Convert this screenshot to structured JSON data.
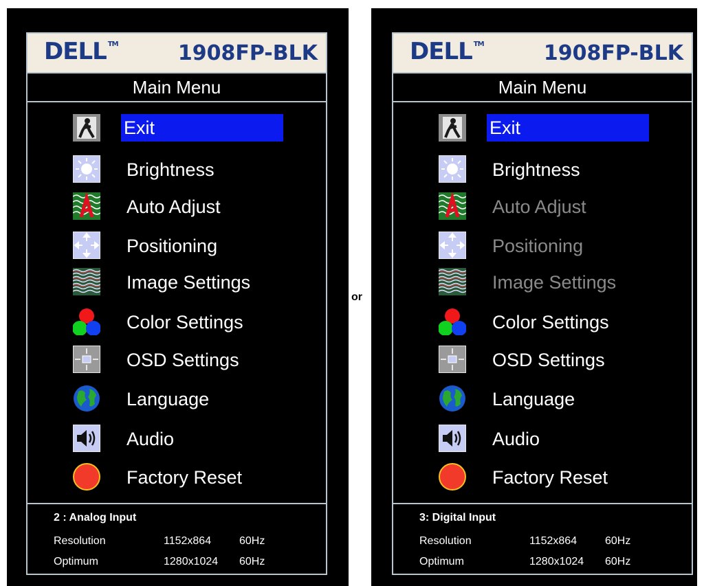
{
  "separator": "or",
  "panels": {
    "left": {
      "logo": "DELL",
      "trademark": "TM",
      "model": "1908FP-BLK",
      "menu_title": "Main Menu",
      "items": [
        {
          "label": "Exit",
          "icon": "exit-icon",
          "state": "selected"
        },
        {
          "label": "Brightness",
          "icon": "brightness-icon",
          "state": "normal"
        },
        {
          "label": "Auto Adjust",
          "icon": "auto-adjust-icon",
          "state": "normal"
        },
        {
          "label": "Positioning",
          "icon": "positioning-icon",
          "state": "normal"
        },
        {
          "label": "Image Settings",
          "icon": "image-settings-icon",
          "state": "normal"
        },
        {
          "label": "Color Settings",
          "icon": "color-settings-icon",
          "state": "normal"
        },
        {
          "label": "OSD Settings",
          "icon": "osd-settings-icon",
          "state": "normal"
        },
        {
          "label": "Language",
          "icon": "globe-icon",
          "state": "normal"
        },
        {
          "label": "Audio",
          "icon": "speaker-icon",
          "state": "normal"
        },
        {
          "label": "Factory Reset",
          "icon": "factory-reset-icon",
          "state": "normal"
        }
      ],
      "info": {
        "input_label": "2 : Analog Input",
        "resolution_label": "Resolution",
        "resolution_value": "1152x864",
        "resolution_hz": "60Hz",
        "optimum_label": "Optimum",
        "optimum_value": "1280x1024",
        "optimum_hz": "60Hz"
      }
    },
    "right": {
      "logo": "DELL",
      "trademark": "TM",
      "model": "1908FP-BLK",
      "menu_title": "Main Menu",
      "items": [
        {
          "label": "Exit",
          "icon": "exit-icon",
          "state": "selected"
        },
        {
          "label": "Brightness",
          "icon": "brightness-icon",
          "state": "normal"
        },
        {
          "label": "Auto Adjust",
          "icon": "auto-adjust-icon",
          "state": "disabled"
        },
        {
          "label": "Positioning",
          "icon": "positioning-icon",
          "state": "disabled"
        },
        {
          "label": "Image Settings",
          "icon": "image-settings-icon",
          "state": "disabled"
        },
        {
          "label": "Color Settings",
          "icon": "color-settings-icon",
          "state": "normal"
        },
        {
          "label": "OSD Settings",
          "icon": "osd-settings-icon",
          "state": "normal"
        },
        {
          "label": "Language",
          "icon": "globe-icon",
          "state": "normal"
        },
        {
          "label": "Audio",
          "icon": "speaker-icon",
          "state": "normal"
        },
        {
          "label": "Factory Reset",
          "icon": "factory-reset-icon",
          "state": "normal"
        }
      ],
      "info": {
        "input_label": "3: Digital Input",
        "resolution_label": "Resolution",
        "resolution_value": "1152x864",
        "resolution_hz": "60Hz",
        "optimum_label": "Optimum",
        "optimum_value": "1280x1024",
        "optimum_hz": "60Hz"
      }
    }
  },
  "colors": {
    "selected": "#0b1bf0",
    "disabled_text": "#8a8a8a",
    "logo": "#1d3a86",
    "header_bg": "#f2ebe0",
    "border": "#b8c7cf"
  }
}
